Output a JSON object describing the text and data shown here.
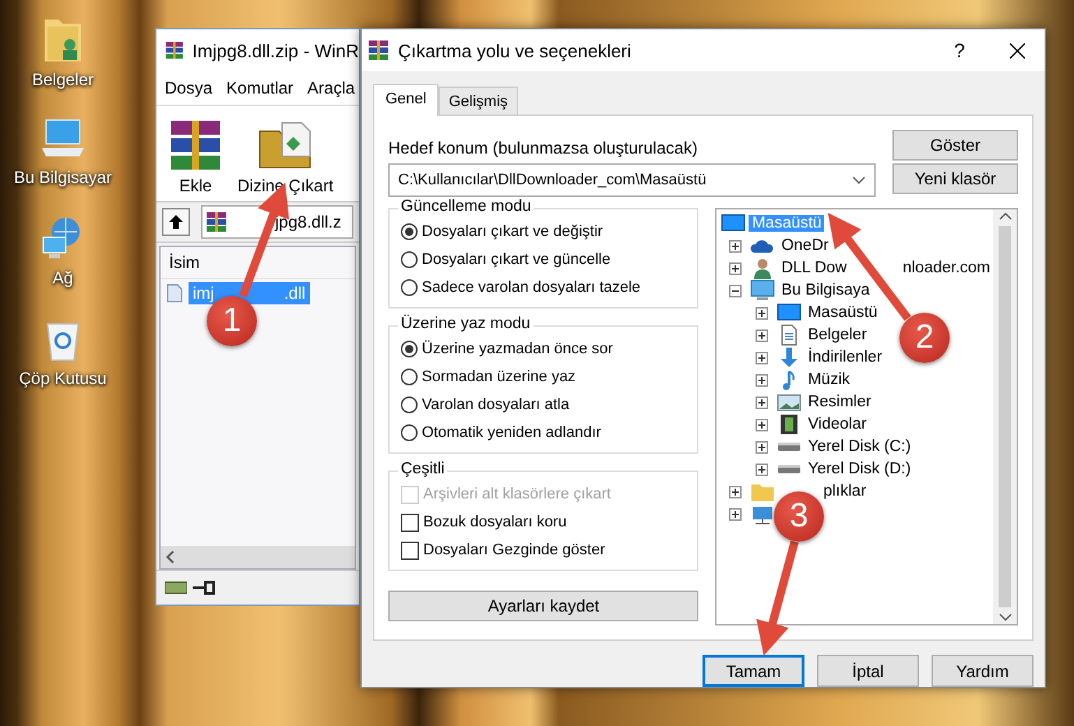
{
  "desktop_icons": [
    {
      "label": "Belgeler",
      "kind": "documents"
    },
    {
      "label": "Bu Bilgisayar",
      "kind": "computer"
    },
    {
      "label": "Ağ",
      "kind": "network"
    },
    {
      "label": "Çöp Kutusu",
      "kind": "recycle"
    }
  ],
  "archive_window": {
    "title": "Imjpg8.dll.zip - WinR",
    "menu": [
      "Dosya",
      "Komutlar",
      "Araçla"
    ],
    "toolbar": [
      {
        "label": "Ekle",
        "kind": "add"
      },
      {
        "label": "Dizine Çıkart",
        "kind": "extract"
      }
    ],
    "address": "jpg8.dll.z",
    "column": "İsim",
    "files": [
      {
        "name": "imj",
        "name_rest": ".dll",
        "selected": true
      }
    ]
  },
  "dialog": {
    "title": "Çıkartma yolu ve seçenekleri",
    "help": "?",
    "tabs": [
      {
        "label": "Genel",
        "selected": true
      },
      {
        "label": "Gelişmiş",
        "selected": false
      }
    ],
    "destination_label": "Hedef konum (bulunmazsa oluşturulacak)",
    "destination_value": "C:\\Kullanıcılar\\DllDownloader_com\\Masaüstü",
    "side_buttons": [
      "Göster",
      "Yeni klasör"
    ],
    "groups": [
      {
        "title": "Güncelleme modu",
        "kind": "radio",
        "options": [
          {
            "label": "Dosyaları çıkart ve değiştir",
            "selected": true
          },
          {
            "label": "Dosyaları çıkart ve güncelle",
            "selected": false
          },
          {
            "label": "Sadece varolan dosyaları tazele",
            "selected": false
          }
        ]
      },
      {
        "title": "Üzerine yaz modu",
        "kind": "radio",
        "options": [
          {
            "label": "Üzerine yazmadan önce sor",
            "selected": true
          },
          {
            "label": "Sormadan üzerine yaz",
            "selected": false
          },
          {
            "label": "Varolan dosyaları atla",
            "selected": false
          },
          {
            "label": "Otomatik yeniden adlandır",
            "selected": false
          }
        ]
      },
      {
        "title": "Çeşitli",
        "kind": "checkbox",
        "options": [
          {
            "label": "Arşivleri alt klasörlere çıkart",
            "checked": false,
            "disabled": true
          },
          {
            "label": "Bozuk dosyaları koru",
            "checked": false,
            "disabled": false
          },
          {
            "label": "Dosyaları Gezginde göster",
            "checked": false,
            "disabled": false
          }
        ]
      }
    ],
    "save_button": "Ayarları kaydet",
    "tree": [
      {
        "label": "Masaüstü",
        "kind": "desktop",
        "selected": true,
        "children": [
          {
            "label": "OneDr",
            "kind": "cloud",
            "selected": false,
            "expanded": false
          },
          {
            "label": "DLL Dow",
            "label_rest": "nloader.com",
            "kind": "person",
            "selected": false,
            "expanded": false
          },
          {
            "label": "Bu Bilgisaya",
            "kind": "computer",
            "selected": false,
            "expanded": true,
            "children": [
              {
                "label": "Masaüstü",
                "kind": "desktop",
                "selected": false,
                "expanded": false
              },
              {
                "label": "Belgeler",
                "kind": "document",
                "selected": false,
                "expanded": false
              },
              {
                "label": "İndirilenler",
                "kind": "download",
                "selected": false,
                "expanded": false
              },
              {
                "label": "Müzik",
                "kind": "music",
                "selected": false,
                "expanded": false
              },
              {
                "label": "Resimler",
                "kind": "picture",
                "selected": false,
                "expanded": false
              },
              {
                "label": "Videolar",
                "kind": "video",
                "selected": false,
                "expanded": false
              },
              {
                "label": "Yerel Disk (C:)",
                "kind": "drive",
                "selected": false,
                "expanded": false
              },
              {
                "label": "Yerel Disk (D:)",
                "kind": "drive",
                "selected": false,
                "expanded": false
              }
            ]
          },
          {
            "label": "plıklar",
            "kind": "library",
            "selected": false,
            "expanded": false
          },
          {
            "kind": "network",
            "expanded": false
          }
        ]
      }
    ],
    "footer_buttons": [
      {
        "label": "Tamam",
        "default": true
      },
      {
        "label": "İptal",
        "default": false
      },
      {
        "label": "Yardım",
        "default": false
      }
    ]
  },
  "annotations": [
    {
      "number": "1"
    },
    {
      "number": "2"
    },
    {
      "number": "3"
    }
  ]
}
